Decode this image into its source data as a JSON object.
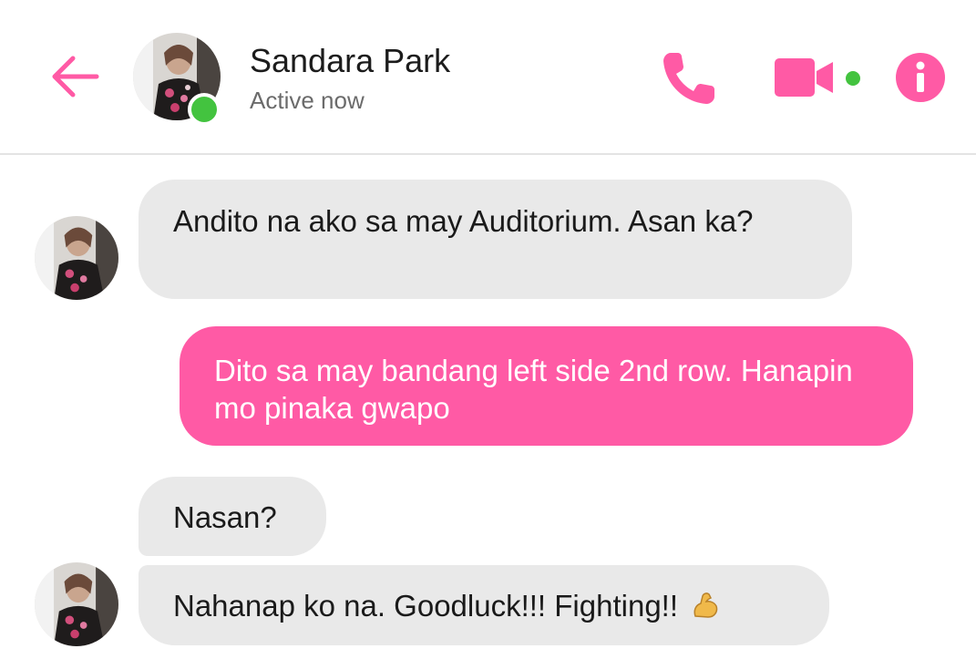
{
  "header": {
    "contact_name": "Sandara Park",
    "status": "Active now",
    "accent_color": "#ff5aa5",
    "online_color": "#43c33f",
    "icons": [
      "back-arrow-icon",
      "phone-icon",
      "video-camera-icon",
      "info-icon"
    ]
  },
  "messages": [
    {
      "sender": "contact",
      "text": "Andito na ako sa may Auditorium. Asan ka?"
    },
    {
      "sender": "me",
      "text": "Dito sa may bandang left side 2nd row. Hanapin mo pinaka gwapo"
    },
    {
      "sender": "contact",
      "text": "Nasan?"
    },
    {
      "sender": "contact",
      "text": "Nahanap ko na. Goodluck!!! Fighting!!",
      "emoji": "flexed-biceps-icon"
    }
  ],
  "colors": {
    "incoming_bubble": "#e9e9e9",
    "outgoing_bubble": "#ff5aa5"
  }
}
